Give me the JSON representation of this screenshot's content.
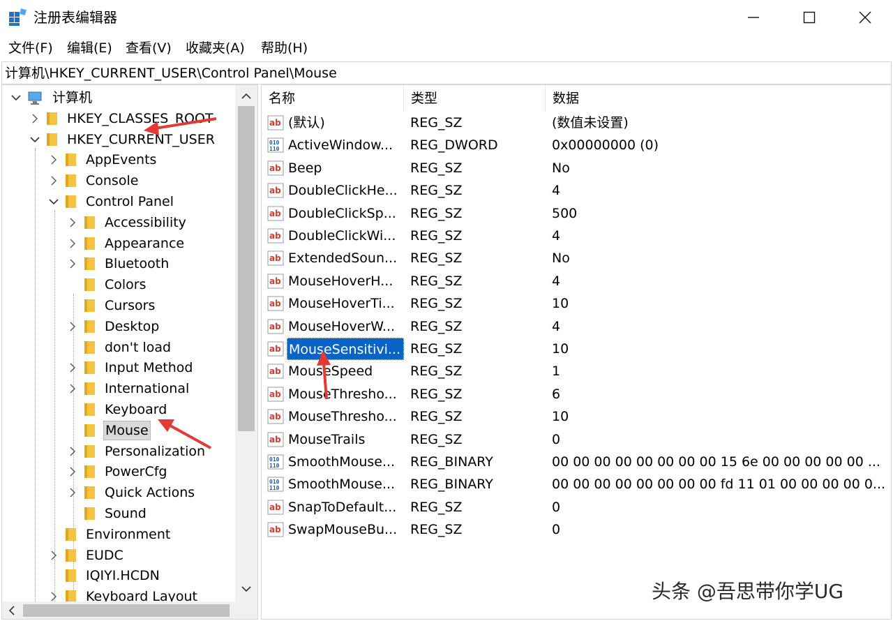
{
  "window": {
    "title": "注册表编辑器"
  },
  "menu": [
    "文件(F)",
    "编辑(E)",
    "查看(V)",
    "收藏夹(A)",
    "帮助(H)"
  ],
  "address": "计算机\\HKEY_CURRENT_USER\\Control Panel\\Mouse",
  "tree": [
    {
      "label": "计算机",
      "expanded": true
    },
    {
      "label": "HKEY_CLASSES_ROOT",
      "expanded": false
    },
    {
      "label": "HKEY_CURRENT_USER",
      "expanded": true
    },
    {
      "label": "AppEvents",
      "expanded": false
    },
    {
      "label": "Console",
      "expanded": false
    },
    {
      "label": "Control Panel",
      "expanded": true
    },
    {
      "label": "Accessibility",
      "expanded": false
    },
    {
      "label": "Appearance",
      "expanded": false
    },
    {
      "label": "Bluetooth",
      "expanded": false
    },
    {
      "label": "Colors"
    },
    {
      "label": "Cursors"
    },
    {
      "label": "Desktop",
      "expanded": false
    },
    {
      "label": "don't load"
    },
    {
      "label": "Input Method",
      "expanded": false
    },
    {
      "label": "International",
      "expanded": false
    },
    {
      "label": "Keyboard"
    },
    {
      "label": "Mouse",
      "selected": true
    },
    {
      "label": "Personalization",
      "expanded": false
    },
    {
      "label": "PowerCfg",
      "expanded": false
    },
    {
      "label": "Quick Actions",
      "expanded": false
    },
    {
      "label": "Sound"
    },
    {
      "label": "Environment"
    },
    {
      "label": "EUDC",
      "expanded": false
    },
    {
      "label": "IQIYI.HCDN"
    },
    {
      "label": "Keyboard Layout",
      "expanded": false
    }
  ],
  "columns": [
    "名称",
    "类型",
    "数据"
  ],
  "values": [
    {
      "name": "(默认)",
      "type": "REG_SZ",
      "data": "(数值未设置)",
      "icon": "string-value-icon"
    },
    {
      "name": "ActiveWindow...",
      "type": "REG_DWORD",
      "data": "0x00000000 (0)",
      "icon": "binary-value-icon"
    },
    {
      "name": "Beep",
      "type": "REG_SZ",
      "data": "No",
      "icon": "string-value-icon"
    },
    {
      "name": "DoubleClickHe...",
      "type": "REG_SZ",
      "data": "4",
      "icon": "string-value-icon"
    },
    {
      "name": "DoubleClickSp...",
      "type": "REG_SZ",
      "data": "500",
      "icon": "string-value-icon"
    },
    {
      "name": "DoubleClickWi...",
      "type": "REG_SZ",
      "data": "4",
      "icon": "string-value-icon"
    },
    {
      "name": "ExtendedSoun...",
      "type": "REG_SZ",
      "data": "No",
      "icon": "string-value-icon"
    },
    {
      "name": "MouseHoverH...",
      "type": "REG_SZ",
      "data": "4",
      "icon": "string-value-icon"
    },
    {
      "name": "MouseHoverTi...",
      "type": "REG_SZ",
      "data": "10",
      "icon": "string-value-icon"
    },
    {
      "name": "MouseHoverW...",
      "type": "REG_SZ",
      "data": "4",
      "icon": "string-value-icon"
    },
    {
      "name": "MouseSensitivi...",
      "type": "REG_SZ",
      "data": "10",
      "icon": "string-value-icon",
      "selected": true
    },
    {
      "name": "MouseSpeed",
      "type": "REG_SZ",
      "data": "1",
      "icon": "string-value-icon"
    },
    {
      "name": "MouseThresho...",
      "type": "REG_SZ",
      "data": "6",
      "icon": "string-value-icon"
    },
    {
      "name": "MouseThresho...",
      "type": "REG_SZ",
      "data": "10",
      "icon": "string-value-icon"
    },
    {
      "name": "MouseTrails",
      "type": "REG_SZ",
      "data": "0",
      "icon": "string-value-icon"
    },
    {
      "name": "SmoothMouse...",
      "type": "REG_BINARY",
      "data": "00 00 00 00 00 00 00 00 15 6e 00 00 00 00 00 ...",
      "icon": "binary-value-icon"
    },
    {
      "name": "SmoothMouse...",
      "type": "REG_BINARY",
      "data": "00 00 00 00 00 00 00 00 fd 11 01 00 00 00 00 0...",
      "icon": "binary-value-icon"
    },
    {
      "name": "SnapToDefault...",
      "type": "REG_SZ",
      "data": "0",
      "icon": "string-value-icon"
    },
    {
      "name": "SwapMouseBu...",
      "type": "REG_SZ",
      "data": "0",
      "icon": "string-value-icon"
    }
  ],
  "watermark": "头条 @吾思带你学UG",
  "colors": {
    "selection": "#0a64c8",
    "annotation_arrow": "#e53935",
    "folder": "#f5c342"
  }
}
